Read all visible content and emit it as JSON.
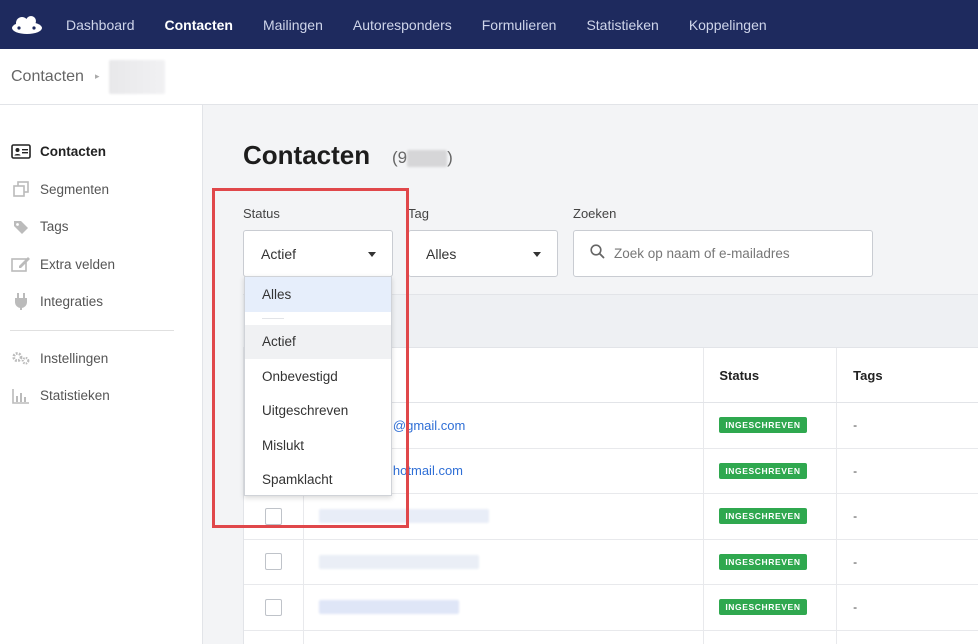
{
  "nav": {
    "logo_icon": "cloud-logo-icon",
    "items": [
      {
        "label": "Dashboard",
        "active": false
      },
      {
        "label": "Contacten",
        "active": true
      },
      {
        "label": "Mailingen",
        "active": false
      },
      {
        "label": "Autoresponders",
        "active": false
      },
      {
        "label": "Formulieren",
        "active": false
      },
      {
        "label": "Statistieken",
        "active": false
      },
      {
        "label": "Koppelingen",
        "active": false
      }
    ]
  },
  "breadcrumb": {
    "root": "Contacten",
    "separator": "▸"
  },
  "sidebar": {
    "items": [
      {
        "label": "Contacten",
        "icon": "contact-card-icon",
        "active": true
      },
      {
        "label": "Segmenten",
        "icon": "segments-icon",
        "active": false
      },
      {
        "label": "Tags",
        "icon": "tag-icon",
        "active": false
      },
      {
        "label": "Extra velden",
        "icon": "edit-fields-icon",
        "active": false
      },
      {
        "label": "Integraties",
        "icon": "plug-icon",
        "active": false
      }
    ],
    "secondary": [
      {
        "label": "Instellingen",
        "icon": "gears-icon"
      },
      {
        "label": "Statistieken",
        "icon": "bar-chart-icon"
      }
    ]
  },
  "page": {
    "title": "Contacten",
    "count_open": "(9",
    "count_close": ")"
  },
  "filters": {
    "status": {
      "label": "Status",
      "value": "Actief"
    },
    "tag": {
      "label": "Tag",
      "value": "Alles"
    },
    "search": {
      "label": "Zoeken",
      "placeholder": "Zoek op naam of e-mailadres"
    }
  },
  "status_dropdown": {
    "options": [
      "Alles",
      "Actief",
      "Onbevestigd",
      "Uitgeschreven",
      "Mislukt",
      "Spamklacht"
    ],
    "highlighted": "Alles",
    "selected": "Actief"
  },
  "table": {
    "headers": {
      "status": "Status",
      "tags": "Tags"
    },
    "rows": [
      {
        "email": "@gmail.com",
        "status": "INGESCHREVEN",
        "tags": "-"
      },
      {
        "email": "hotmail.com",
        "status": "INGESCHREVEN",
        "tags": "-"
      },
      {
        "email": "",
        "status": "INGESCHREVEN",
        "tags": "-"
      },
      {
        "email": "",
        "status": "INGESCHREVEN",
        "tags": "-"
      },
      {
        "email": "",
        "status": "INGESCHREVEN",
        "tags": "-"
      }
    ]
  },
  "colors": {
    "nav_bg": "#1e2a5e",
    "badge_green": "#2fa84f",
    "link_blue": "#2f6fd6",
    "highlight_red": "#e0474a"
  }
}
